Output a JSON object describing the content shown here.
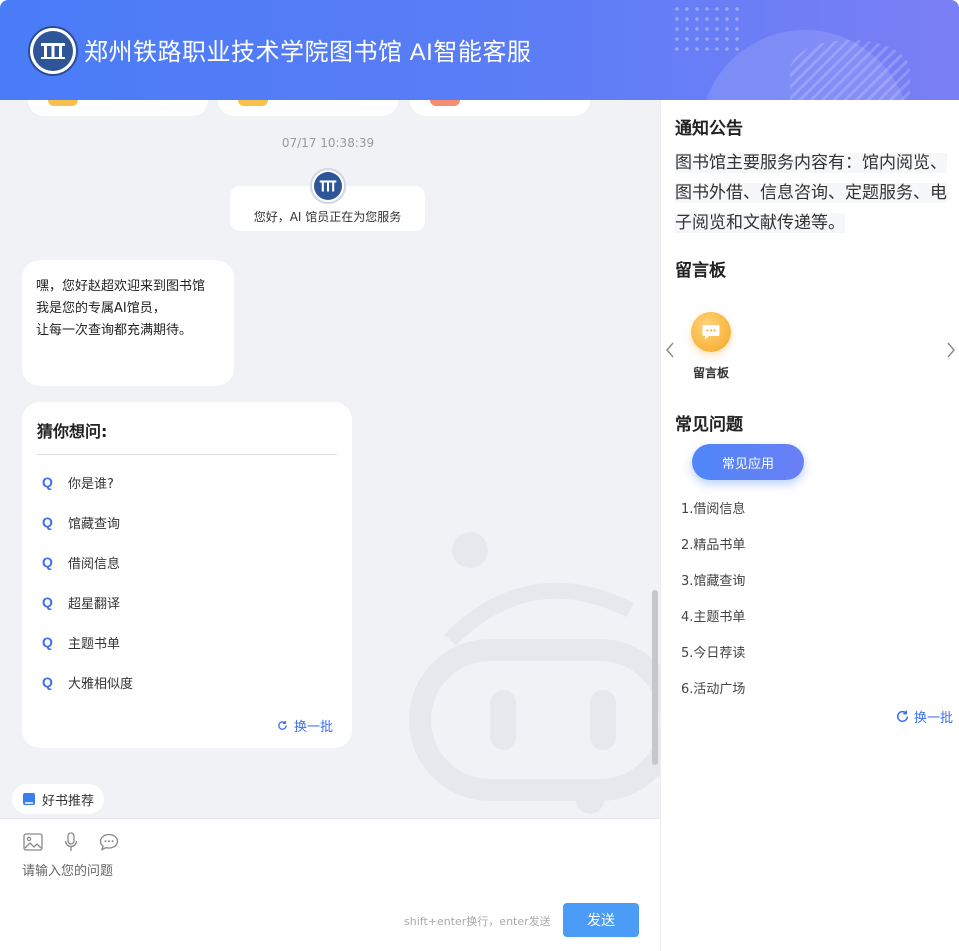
{
  "header": {
    "title": "郑州铁路职业技术学院图书馆 AI智能客服"
  },
  "chat": {
    "timestamp": "07/17 10:38:39",
    "system_message": "您好，AI 馆员正在为您服务",
    "welcome_lines": [
      "嘿，您好赵超欢迎来到图书馆",
      "我是您的专属AI馆员，",
      "让每一次查询都充满期待。"
    ],
    "guess": {
      "title": "猜你想问:",
      "q_marker": "Q",
      "items": [
        "你是谁?",
        "馆藏查询",
        "借阅信息",
        "超星翻译",
        "主题书单",
        "大雅相似度"
      ],
      "refresh_label": "换一批"
    },
    "book_chip": "好书推荐"
  },
  "input": {
    "placeholder": "请输入您的问题",
    "hint": "shift+enter换行，enter发送",
    "send_label": "发送"
  },
  "right": {
    "notice_title": "通知公告",
    "notice_text": "图书馆主要服务内容有：馆内阅览、图书外借、信息咨询、定题服务、电子阅览和文献传递等。",
    "board_title": "留言板",
    "board_item_label": "留言板",
    "faq_title": "常见问题",
    "faq_tab": "常见应用",
    "faq_items": [
      "1.借阅信息",
      "2.精品书单",
      "3.馆藏查询",
      "4.主题书单",
      "5.今日荐读",
      "6.活动广场"
    ],
    "refresh_label": "换一批"
  },
  "colors": {
    "header_start": "#4a7cf7",
    "accent_blue": "#3a6ff0",
    "send_button": "#4a9cf6",
    "message_icon": "#f5a623"
  }
}
